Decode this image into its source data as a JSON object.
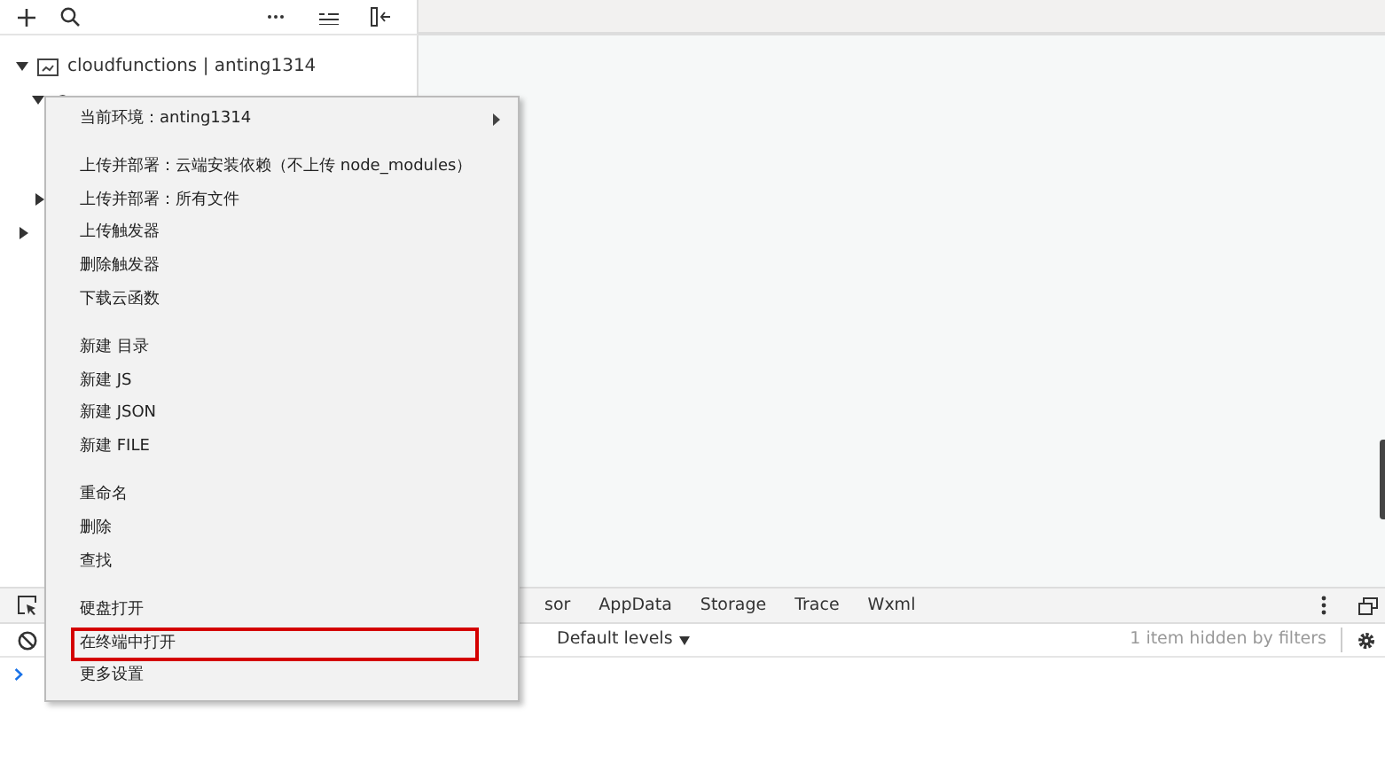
{
  "explorer": {
    "root": {
      "label": "cloudfunctions | anting1314",
      "expanded": true
    }
  },
  "context_menu": {
    "groups": [
      [
        {
          "label": "当前环境：anting1314",
          "submenu": true,
          "highlighted": false
        }
      ],
      [
        {
          "label": "上传并部署：云端安装依赖（不上传 node_modules）",
          "submenu": false,
          "highlighted": false
        },
        {
          "label": "上传并部署：所有文件",
          "submenu": false,
          "highlighted": false
        },
        {
          "label": "上传触发器",
          "submenu": false,
          "highlighted": false
        },
        {
          "label": "删除触发器",
          "submenu": false,
          "highlighted": false
        },
        {
          "label": "下载云函数",
          "submenu": false,
          "highlighted": false
        }
      ],
      [
        {
          "label": "新建 目录",
          "submenu": false,
          "highlighted": false
        },
        {
          "label": "新建 JS",
          "submenu": false,
          "highlighted": false
        },
        {
          "label": "新建 JSON",
          "submenu": false,
          "highlighted": false
        },
        {
          "label": "新建 FILE",
          "submenu": false,
          "highlighted": false
        }
      ],
      [
        {
          "label": "重命名",
          "submenu": false,
          "highlighted": false
        },
        {
          "label": "删除",
          "submenu": false,
          "highlighted": false
        },
        {
          "label": "查找",
          "submenu": false,
          "highlighted": false
        }
      ],
      [
        {
          "label": "硬盘打开",
          "submenu": false,
          "highlighted": false
        },
        {
          "label": "在终端中打开",
          "submenu": false,
          "highlighted": true
        },
        {
          "label": "更多设置",
          "submenu": false,
          "highlighted": false
        }
      ]
    ]
  },
  "devtools": {
    "tabs": [
      {
        "label": "sor",
        "selected": false
      },
      {
        "label": "AppData",
        "selected": false
      },
      {
        "label": "Storage",
        "selected": false
      },
      {
        "label": "Trace",
        "selected": false
      },
      {
        "label": "Wxml",
        "selected": false
      }
    ],
    "levels": "Default levels",
    "hidden_note": "1 item hidden by filters"
  }
}
